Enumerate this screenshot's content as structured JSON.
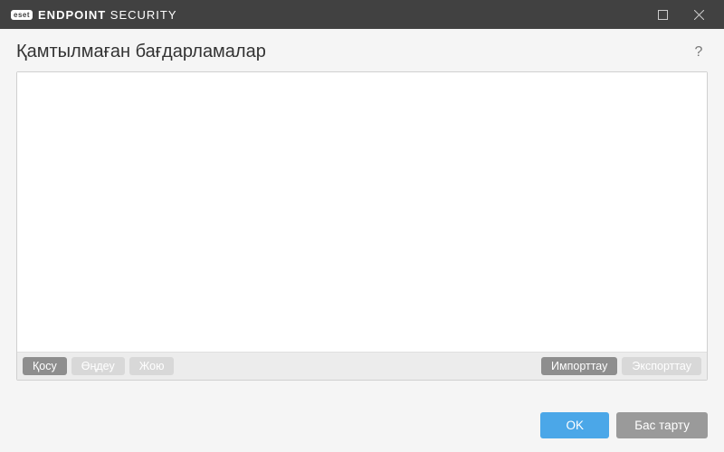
{
  "titlebar": {
    "brand_badge": "eset",
    "brand_bold": "ENDPOINT",
    "brand_light": " SECURITY"
  },
  "header": {
    "title": "Қамтылмаған бағдарламалар"
  },
  "toolbar": {
    "add": "Қосу",
    "edit": "Өңдеу",
    "delete": "Жою",
    "import": "Импорттау",
    "export": "Экспорттау"
  },
  "list": {
    "items": []
  },
  "footer": {
    "ok": "OK",
    "cancel": "Бас тарту"
  }
}
